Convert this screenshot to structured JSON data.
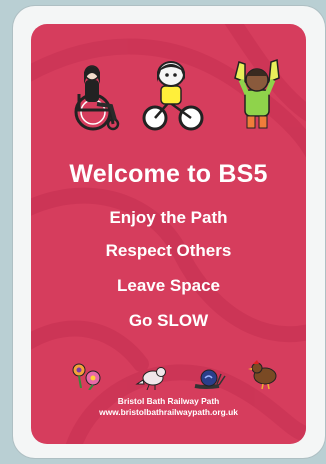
{
  "sign": {
    "title": "Welcome to BS5",
    "lines": [
      "Enjoy the Path",
      "Respect Others",
      "Leave Space",
      "Go SLOW"
    ],
    "footer_name": "Bristol Bath Railway Path",
    "footer_url": "www.bristolbathrailwaypath.org.uk"
  },
  "icons": {
    "figures": [
      "wheelchair-user-icon",
      "child-on-bike-icon",
      "child-waving-icon"
    ],
    "animals": [
      "flowers-icon",
      "bird-icon",
      "snail-icon",
      "hen-icon"
    ]
  },
  "colors": {
    "sign_background": "#d63d5d",
    "frame": "#f4f6f6",
    "page_background": "#b9cfd3"
  }
}
